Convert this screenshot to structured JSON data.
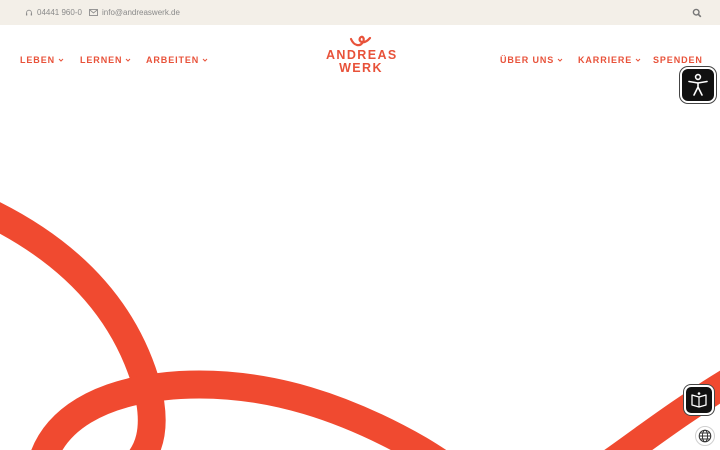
{
  "topbar": {
    "phone": "04441 960-0",
    "email": "info@andreaswerk.de",
    "icons": {
      "phone": "headset-icon",
      "email": "mail-icon",
      "search": "search-icon"
    }
  },
  "nav": {
    "left": [
      {
        "label": "LEBEN",
        "has_dropdown": true
      },
      {
        "label": "LERNEN",
        "has_dropdown": true
      },
      {
        "label": "ARBEITEN",
        "has_dropdown": true
      }
    ],
    "right": [
      {
        "label": "ÜBER UNS",
        "has_dropdown": true
      },
      {
        "label": "KARRIERE",
        "has_dropdown": true
      },
      {
        "label": "SPENDEN",
        "has_dropdown": false
      }
    ]
  },
  "logo": {
    "line1": "ANDREAS",
    "line2": "WERK"
  },
  "widgets": {
    "accessibility": "accessibility-icon",
    "easy_read": "book-icon",
    "language": "globe-icon"
  },
  "colors": {
    "accent": "#e8523a",
    "ribbon": "#f04a30",
    "topbar": "#f3efe8",
    "muted": "#8a8a8a"
  }
}
